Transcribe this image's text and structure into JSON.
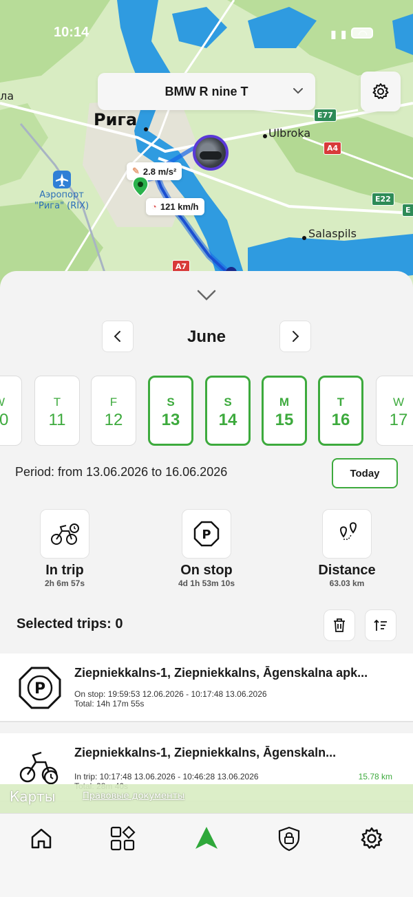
{
  "status_bar": {
    "time": "10:14"
  },
  "map": {
    "city": "Рига",
    "places": {
      "ulbroka": "Ulbroka",
      "salaspils": "Salaspils",
      "edge_left": "ла"
    },
    "airport": {
      "line1": "Аэропорт",
      "line2": "\"Рига\" (RIX)"
    },
    "roads": {
      "e77": "E77",
      "a4": "A4",
      "e22": "E22",
      "a7": "A7",
      "e_edge": "E"
    },
    "accel_label": "2.8 m/s²",
    "speed_label": "121 km/h",
    "attribution": {
      "maps": "Карты",
      "legal": "Правовые документы"
    }
  },
  "vehicle": {
    "name": "BMW R nine T"
  },
  "calendar": {
    "month": "June",
    "days": [
      {
        "dn": "W",
        "dd": "10",
        "selected": false
      },
      {
        "dn": "T",
        "dd": "11",
        "selected": false
      },
      {
        "dn": "F",
        "dd": "12",
        "selected": false
      },
      {
        "dn": "S",
        "dd": "13",
        "selected": true
      },
      {
        "dn": "S",
        "dd": "14",
        "selected": true
      },
      {
        "dn": "M",
        "dd": "15",
        "selected": true
      },
      {
        "dn": "T",
        "dd": "16",
        "selected": true
      },
      {
        "dn": "W",
        "dd": "17",
        "selected": false
      }
    ],
    "period": "Period: from 13.06.2026 to 16.06.2026",
    "today_label": "Today"
  },
  "stats": {
    "in_trip": {
      "title": "In trip",
      "value": "2h 6m 57s"
    },
    "on_stop": {
      "title": "On stop",
      "value": "4d 1h 53m 10s"
    },
    "distance": {
      "title": "Distance",
      "value": "63.03 km"
    }
  },
  "selected_trips": "Selected trips: 0",
  "trips": [
    {
      "type": "stop",
      "title": "Ziepniekkalns-1, Ziepniekkalns, Āgenskalna apk...",
      "line1": "On stop: 19:59:53 12.06.2026 - 10:17:48 13.06.2026",
      "line2": "Total: 14h 17m 55s",
      "distance": ""
    },
    {
      "type": "trip",
      "title": "Ziepniekkalns-1, Ziepniekkalns, Āgenskaln...",
      "line1": "In trip: 10:17:48 13.06.2026 - 10:46:28 13.06.2026",
      "line2": "Total: 28m 40s",
      "distance": "15.78 km"
    }
  ],
  "colors": {
    "accent": "#3daa3d",
    "route": "#1565e8",
    "avatar_ring": "#5b39d8"
  }
}
